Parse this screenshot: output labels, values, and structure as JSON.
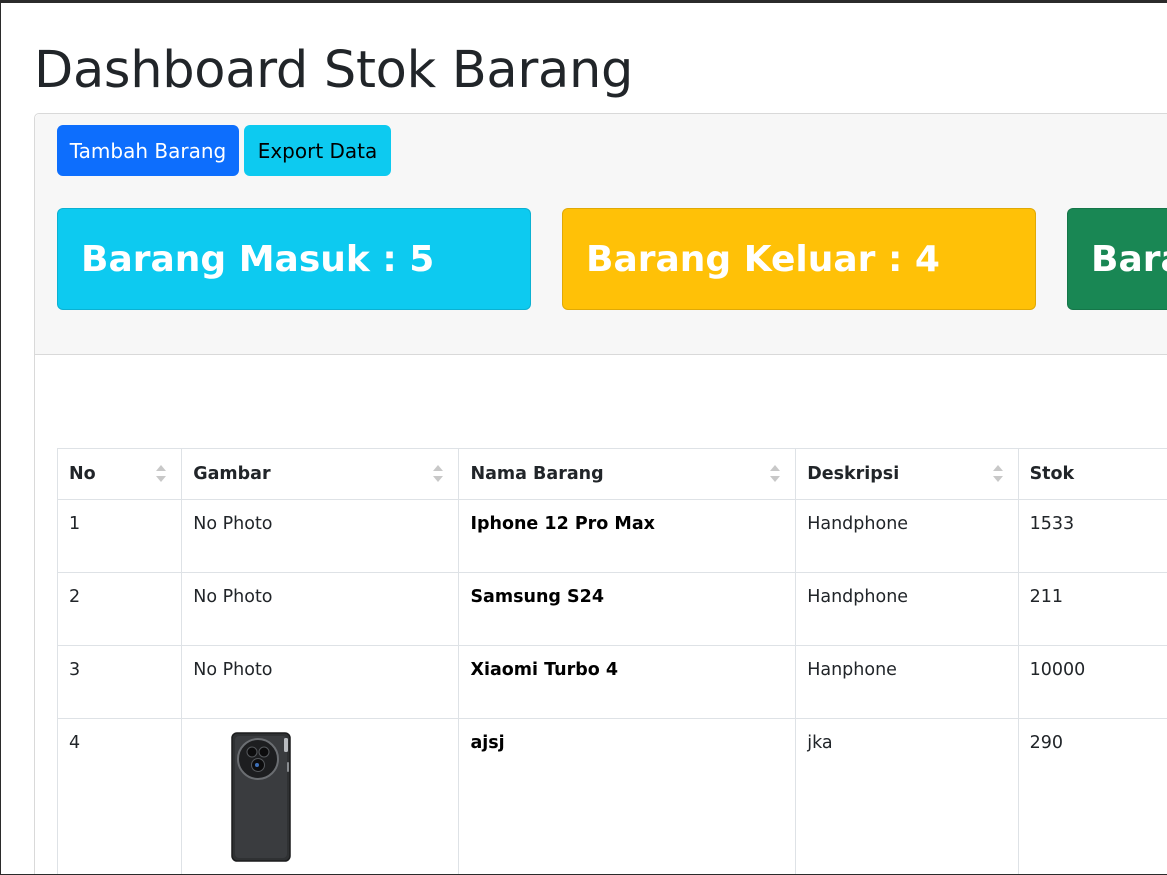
{
  "page": {
    "title": "Dashboard Stok Barang"
  },
  "toolbar": {
    "add_label": "Tambah Barang",
    "export_label": "Export Data"
  },
  "stats": {
    "masuk": "Barang Masuk : 5",
    "keluar": "Barang Keluar : 4",
    "total": "Bara"
  },
  "colors": {
    "primary": "#0d6efd",
    "info": "#0dcaf0",
    "warning": "#ffc107",
    "success": "#198754"
  },
  "table": {
    "headers": [
      "No",
      "Gambar",
      "Nama Barang",
      "Deskripsi",
      "Stok"
    ],
    "rows": [
      {
        "no": "1",
        "gambar": "No Photo",
        "nama": "Iphone 12 Pro Max",
        "deskripsi": "Handphone",
        "stok": "1533"
      },
      {
        "no": "2",
        "gambar": "No Photo",
        "nama": "Samsung S24",
        "deskripsi": "Handphone",
        "stok": "211"
      },
      {
        "no": "3",
        "gambar": "No Photo",
        "nama": "Xiaomi Turbo 4",
        "deskripsi": "Hanphone",
        "stok": "10000"
      },
      {
        "no": "4",
        "gambar": "",
        "nama": "ajsj",
        "deskripsi": "jka",
        "stok": "290"
      }
    ]
  }
}
